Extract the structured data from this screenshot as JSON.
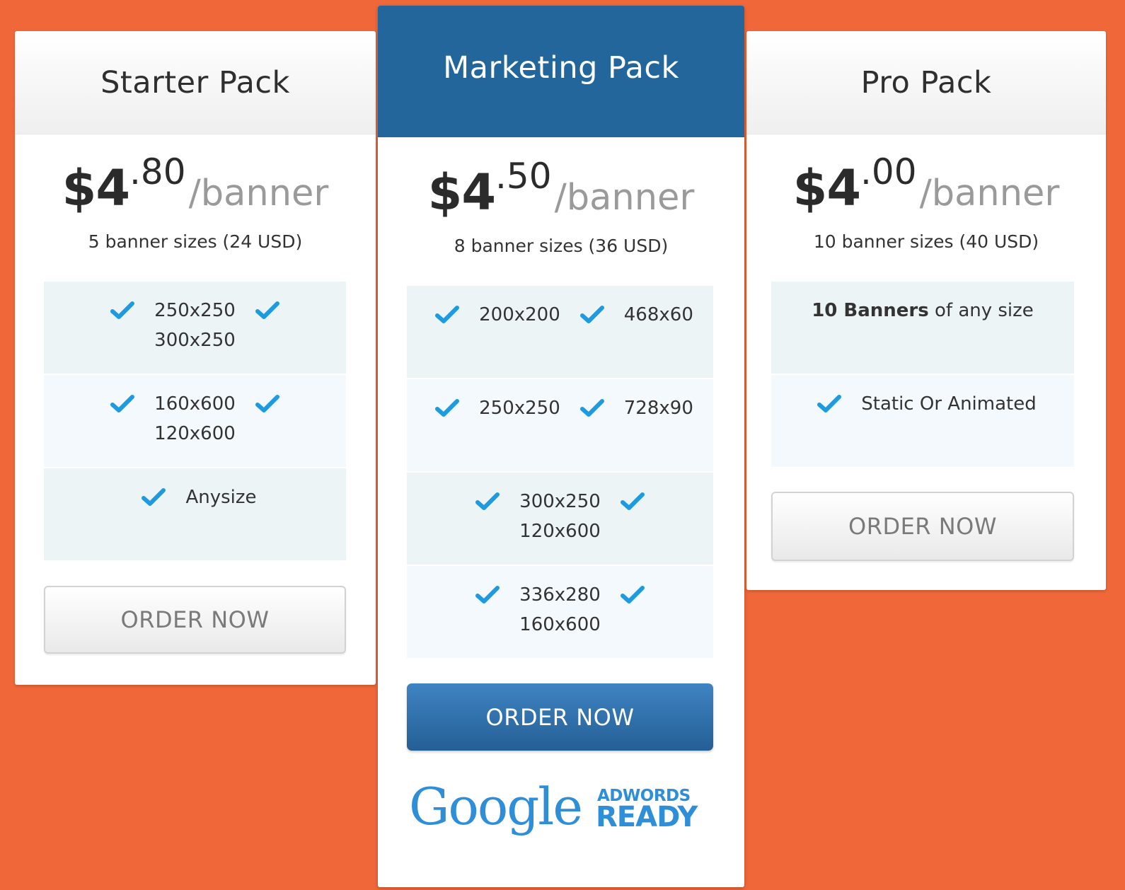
{
  "colors": {
    "background": "#f0683a",
    "featured_header": "#23669c",
    "check": "#1e9be0",
    "primary_button": "#2d6ea8"
  },
  "plans": {
    "starter": {
      "title": "Starter Pack",
      "price_dollars": "$4",
      "price_cents": ".80",
      "price_unit": "/banner",
      "sizes_note": "5 banner sizes (24 USD)",
      "features": {
        "r1": {
          "a": "250x250",
          "b": "300x250"
        },
        "r2": {
          "a": "160x600",
          "b": "120x600"
        },
        "r3": {
          "a": "Anysize"
        }
      },
      "order_label": "ORDER NOW"
    },
    "marketing": {
      "title": "Marketing Pack",
      "price_dollars": "$4",
      "price_cents": ".50",
      "price_unit": "/banner",
      "sizes_note": "8 banner sizes (36 USD)",
      "features": {
        "r1": {
          "a": "200x200",
          "b": "468x60"
        },
        "r2": {
          "a": "250x250",
          "b": "728x90"
        },
        "r3": {
          "a": "300x250",
          "b": "120x600"
        },
        "r4": {
          "a": "336x280",
          "b": "160x600"
        }
      },
      "order_label": "ORDER NOW",
      "badge": {
        "google": "Google",
        "line1": "ADWORDS",
        "line2": "READY"
      }
    },
    "pro": {
      "title": "Pro Pack",
      "price_dollars": "$4",
      "price_cents": ".00",
      "price_unit": "/banner",
      "sizes_note": "10 banner sizes (40 USD)",
      "features": {
        "r1": {
          "bold": "10 Banners",
          "rest": " of any size"
        },
        "r2": {
          "a": "Static Or Animated"
        }
      },
      "order_label": "ORDER NOW"
    }
  }
}
